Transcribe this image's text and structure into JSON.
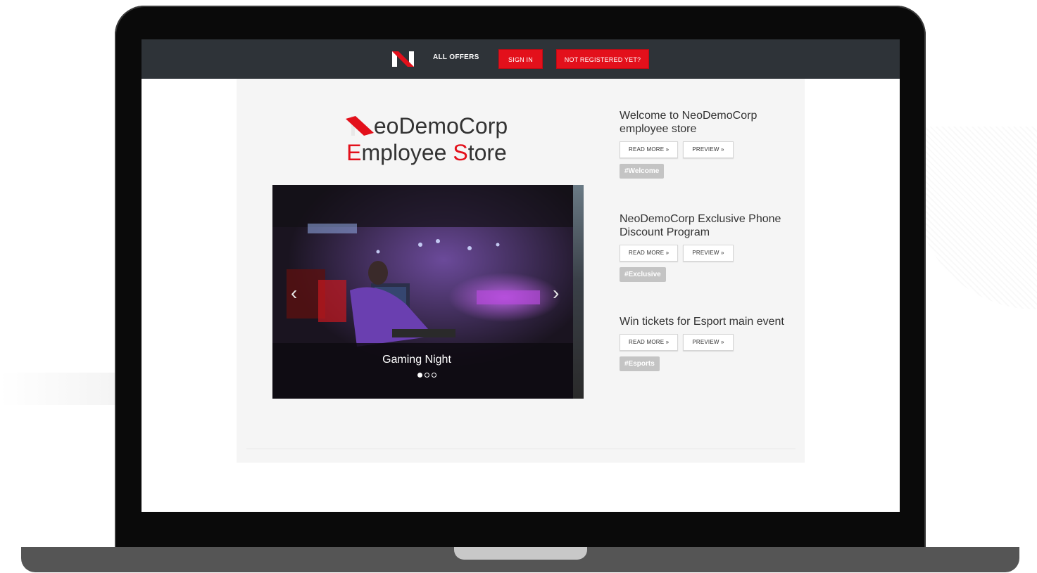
{
  "nav": {
    "all_offers": "ALL OFFERS",
    "sign_in": "SIGN IN",
    "not_registered": "NOT REGISTERED YET?"
  },
  "store": {
    "title_initial": "",
    "title_rest": "eoDemoCorp",
    "line2_e": "E",
    "line2_mid": "mployee ",
    "line2_s": "S",
    "line2_end": "tore"
  },
  "carousel": {
    "caption": "Gaming Night",
    "slides": 3,
    "active_slide": 1,
    "prev_icon": "chevron-left-icon",
    "next_icon": "chevron-right-icon"
  },
  "offers": [
    {
      "title": "Welcome to NeoDemoCorp employee store",
      "read_more": "READ MORE »",
      "preview": "PREVIEW »",
      "tag": "#Welcome"
    },
    {
      "title": "NeoDemoCorp Exclusive Phone Discount Program",
      "read_more": "READ MORE »",
      "preview": "PREVIEW »",
      "tag": "#Exclusive"
    },
    {
      "title": "Win tickets for Esport main event",
      "read_more": "READ MORE »",
      "preview": "PREVIEW »",
      "tag": "#Esports"
    }
  ],
  "colors": {
    "accent_red": "#e3101b",
    "nav_bg": "#2e3338",
    "content_bg": "#f5f5f5",
    "tag_bg": "#c4c4c4"
  }
}
